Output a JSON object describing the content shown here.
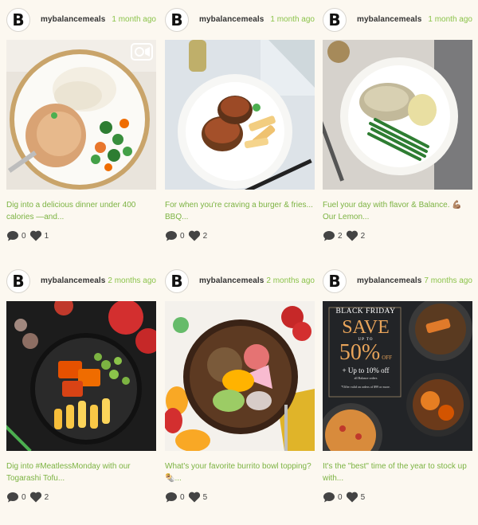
{
  "posts": [
    {
      "avatar": "B",
      "user": "mybalancemeals",
      "time": "1 month ago",
      "caption": "Dig into a delicious dinner under 400 calories —and...",
      "comments": "0",
      "likes": "1",
      "image": "chicken-with-rice-and-vegetables",
      "video": true
    },
    {
      "avatar": "B",
      "user": "mybalancemeals",
      "time": "1 month ago",
      "caption": "For when you're craving a burger & fries... BBQ...",
      "comments": "0",
      "likes": "2",
      "image": "bbq-burger-patties-with-fries",
      "video": false
    },
    {
      "avatar": "B",
      "user": "mybalancemeals",
      "time": "1 month ago",
      "caption": "Fuel your day with flavor & Balance. 💪🏽 Our Lemon...",
      "comments": "2",
      "likes": "2",
      "image": "lemon-chicken-with-green-beans",
      "video": false
    },
    {
      "avatar": "B",
      "user": "mybalancemeals",
      "time": "2 months ago",
      "caption": "Dig into #MeatlessMonday with our Togarashi Tofu...",
      "comments": "0",
      "likes": "2",
      "image": "togarashi-tofu-bowl",
      "video": false
    },
    {
      "avatar": "B",
      "user": "mybalancemeals",
      "time": "2 months ago",
      "caption": "What's your favorite burrito bowl topping? 🌯...",
      "comments": "0",
      "likes": "5",
      "image": "burrito-bowl",
      "video": false
    },
    {
      "avatar": "B",
      "user": "mybalancemeals",
      "time": "7 months ago",
      "caption": "It's the \"best\" time of the year to stock up with...",
      "comments": "0",
      "likes": "5",
      "image": "black-friday-promo",
      "video": false,
      "promo": {
        "line1": "BLACK FRIDAY",
        "line2": "SAVE",
        "line3": "UP TO",
        "line4": "50%",
        "line5": "OFF",
        "line6": "+ Up to 10% off",
        "line7": "all Balance orders",
        "line8": "*Offer valid on orders of $99 or more."
      }
    }
  ],
  "colors": {
    "background": "#fcf8f0",
    "accent": "#8bc34a",
    "caption": "#7cb342",
    "promo_gold": "#e8a45a"
  }
}
